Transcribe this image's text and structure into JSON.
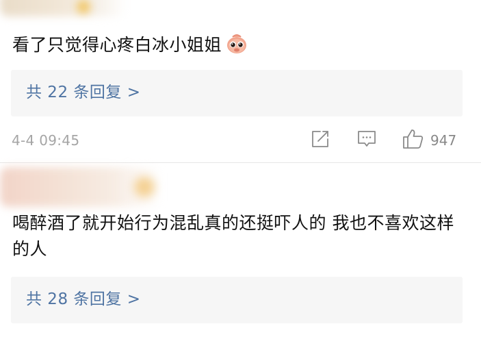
{
  "comments": [
    {
      "text": "看了只觉得心疼白冰小姐姐",
      "emoji_icon": "pig-face-icon",
      "reply_summary": "共 22 条回复 >",
      "timestamp": "4-4 09:45",
      "like_count": "947"
    },
    {
      "text": "喝醉酒了就开始行为混乱真的还挺吓人的 我也不喜欢这样的人",
      "reply_summary": "共 28 条回复 >"
    }
  ],
  "icons": {
    "share": "share-icon",
    "comment": "comment-icon",
    "like": "thumbs-up-icon"
  },
  "colors": {
    "link": "#4f74a3",
    "meta": "#a5a5a5",
    "reply_bg": "#f6f6f6"
  }
}
